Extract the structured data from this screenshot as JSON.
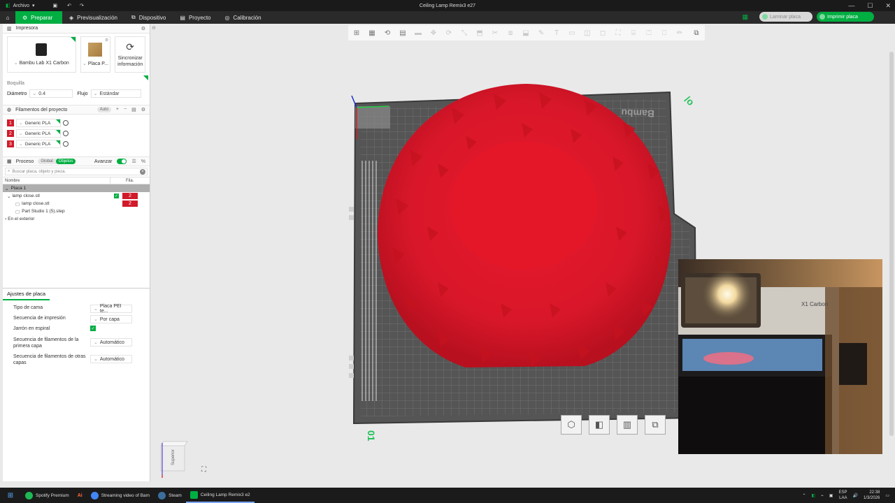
{
  "window": {
    "menu_label": "Archivo",
    "title": "Ceiling Lamp Remix3 e27",
    "controls": [
      "—",
      "☐",
      "✕"
    ]
  },
  "nav": {
    "tabs": [
      "Preparar",
      "Previsualización",
      "Dispositivo",
      "Proyecto",
      "Calibración"
    ],
    "slice_button": "Laminar placa",
    "print_button": "Imprimir placa"
  },
  "printer": {
    "section_title": "Impresora",
    "printer_name": "Bambu Lab X1 Carbon",
    "plate_name": "Placa P...",
    "sync_label": "Sincronizar información",
    "nozzle_label": "Boquilla",
    "diameter_label": "Diámetro",
    "diameter_value": "0.4",
    "flow_label": "Flujo",
    "flow_value": "Estándar"
  },
  "filaments": {
    "section_title": "Filamentos del proyecto",
    "auto_label": "Auto",
    "items": [
      {
        "num": "1",
        "name": "Generic PLA"
      },
      {
        "num": "2",
        "name": "Generic PLA"
      },
      {
        "num": "3",
        "name": "Generic PLA"
      }
    ],
    "color": "#d11a2a"
  },
  "process": {
    "section_title": "Proceso",
    "toggle_global": "Global",
    "toggle_objects": "Objetos",
    "advanced_label": "Avanzar",
    "search_placeholder": "Buscar placa, objeto y pieza.",
    "col_name": "Nombre",
    "col_fila": "Fila.",
    "tree": {
      "plate": "Placa 1",
      "object": "lamp close.stl",
      "object_filament": "2",
      "parts": [
        {
          "name": "lamp close.stl",
          "filament": "2"
        },
        {
          "name": "Part Studio 1 (5).step"
        }
      ],
      "outside": "En el exterior"
    }
  },
  "plate_settings": {
    "tab": "Ajustes de placa",
    "rows": [
      {
        "label": "Tipo de cama",
        "value": "Placa PEI te..."
      },
      {
        "label": "Secuencia de impresión",
        "value": "Por capa"
      },
      {
        "label": "Jarrón en espiral",
        "value": "checked"
      },
      {
        "label": "Secuencia de filamentos de la primera capa",
        "value": "Automático"
      },
      {
        "label": "Secuencia de filamentos de otras capas",
        "value": "Automático"
      }
    ]
  },
  "viewport": {
    "bed_brand": "Bambu",
    "plate_number": "01",
    "view_cube_label": "Superior",
    "camera_brand": "X1 Carbon",
    "model_color": "#e0192b",
    "bed_color": "#5a5a5a"
  },
  "taskbar": {
    "apps": [
      {
        "label": "Spotify Premium",
        "color": "#1db954"
      },
      {
        "label": "",
        "color": "#cc2222"
      },
      {
        "label": "Streaming video of Bam",
        "color": "#4285f4"
      },
      {
        "label": "Steam",
        "color": "#1b2838"
      },
      {
        "label": "Ceiling Lamp Remix3 e2",
        "color": "#00ae42"
      }
    ],
    "lang_top": "ESP",
    "lang_bottom": "LAA",
    "time": "22:38",
    "date": "1/3/2026"
  }
}
